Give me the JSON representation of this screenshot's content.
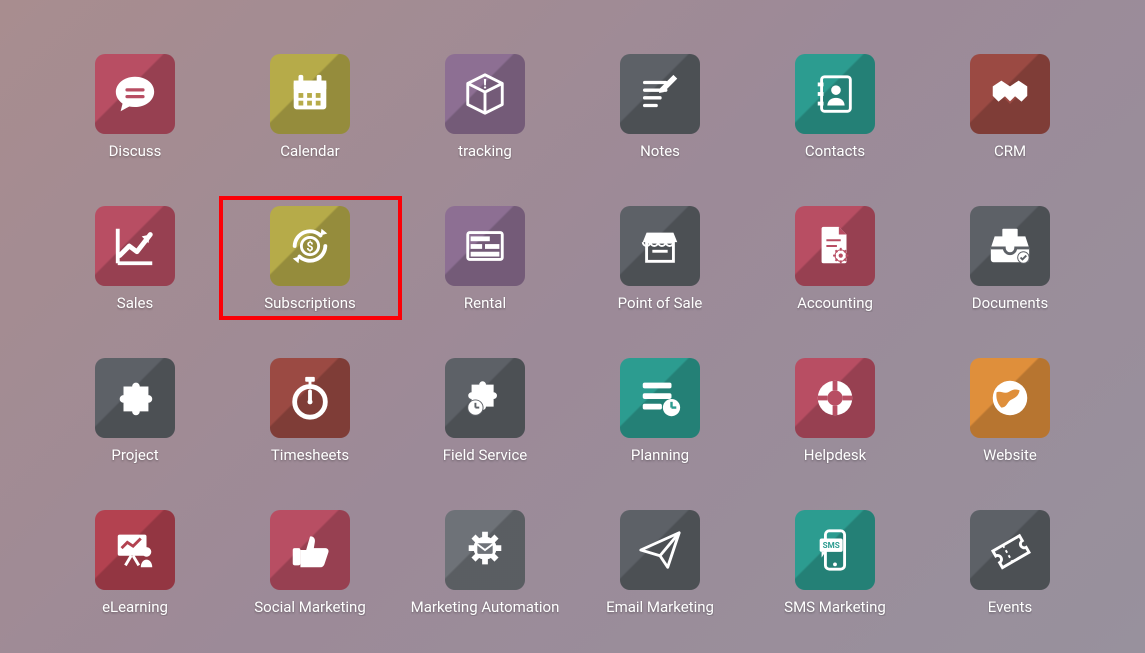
{
  "highlight_index": 7,
  "colors": {
    "rose": "#b84e63",
    "olive": "#b6ab49",
    "plum": "#8d6f93",
    "slate": "#5d6167",
    "teal": "#2c9c90",
    "brick": "#9b4a43",
    "green": "#5fa763",
    "orange": "#df8f3b",
    "crimson": "#b34250",
    "grey": "#6e7278"
  },
  "apps": [
    {
      "label": "Discuss",
      "color_key": "rose",
      "icon": "chat-icon"
    },
    {
      "label": "Calendar",
      "color_key": "olive",
      "icon": "calendar-icon"
    },
    {
      "label": "tracking",
      "color_key": "plum",
      "icon": "package-icon"
    },
    {
      "label": "Notes",
      "color_key": "slate",
      "icon": "note-pencil-icon"
    },
    {
      "label": "Contacts",
      "color_key": "teal",
      "icon": "address-book-icon"
    },
    {
      "label": "CRM",
      "color_key": "brick",
      "icon": "handshake-icon"
    },
    {
      "label": "Sales",
      "color_key": "rose",
      "icon": "chart-up-icon"
    },
    {
      "label": "Subscriptions",
      "color_key": "olive",
      "icon": "dollar-cycle-icon"
    },
    {
      "label": "Rental",
      "color_key": "plum",
      "icon": "schedule-grid-icon"
    },
    {
      "label": "Point of Sale",
      "color_key": "slate",
      "icon": "storefront-icon"
    },
    {
      "label": "Accounting",
      "color_key": "rose",
      "icon": "file-gear-icon"
    },
    {
      "label": "Documents",
      "color_key": "slate",
      "icon": "inbox-check-icon"
    },
    {
      "label": "Project",
      "color_key": "slate",
      "icon": "puzzle-icon"
    },
    {
      "label": "Timesheets",
      "color_key": "brick",
      "icon": "stopwatch-icon"
    },
    {
      "label": "Field Service",
      "color_key": "slate",
      "icon": "puzzle-clock-icon"
    },
    {
      "label": "Planning",
      "color_key": "teal",
      "icon": "list-clock-icon"
    },
    {
      "label": "Helpdesk",
      "color_key": "rose",
      "icon": "lifebuoy-icon"
    },
    {
      "label": "Website",
      "color_key": "orange",
      "icon": "globe-icon"
    },
    {
      "label": "eLearning",
      "color_key": "crimson",
      "icon": "board-person-icon"
    },
    {
      "label": "Social Marketing",
      "color_key": "rose",
      "icon": "thumbs-up-icon"
    },
    {
      "label": "Marketing Automation",
      "color_key": "grey",
      "icon": "gear-mail-icon"
    },
    {
      "label": "Email Marketing",
      "color_key": "slate",
      "icon": "paper-plane-icon"
    },
    {
      "label": "SMS Marketing",
      "color_key": "teal",
      "icon": "phone-sms-icon"
    },
    {
      "label": "Events",
      "color_key": "slate",
      "icon": "ticket-icon"
    }
  ]
}
